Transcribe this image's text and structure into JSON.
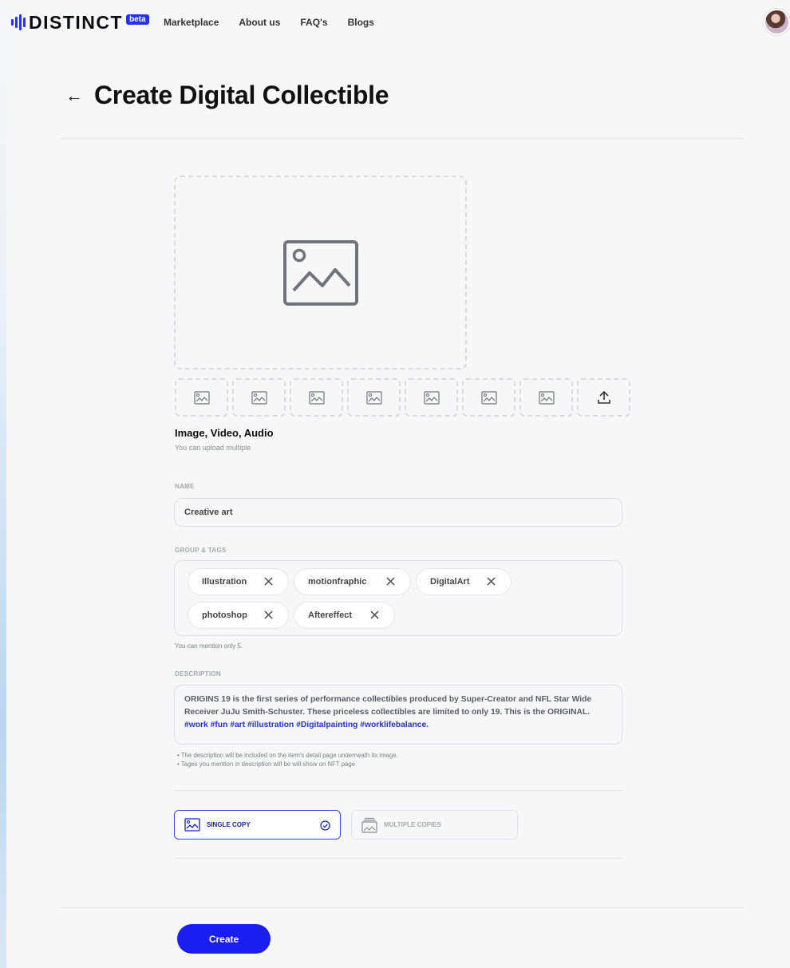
{
  "header": {
    "logo_text": "DISTINCT",
    "logo_badge": "beta",
    "nav": [
      "Marketplace",
      "About us",
      "FAQ's",
      "Blogs"
    ]
  },
  "page": {
    "back_symbol": "←",
    "title": "Create Digital Collectible"
  },
  "media": {
    "title": "Image, Video,  Audio",
    "subtitle": "You can upload multiple",
    "thumb_icons": [
      "image-icon",
      "image-icon",
      "image-icon",
      "image-icon",
      "image-icon",
      "image-icon",
      "image-icon",
      "upload-icon"
    ]
  },
  "name": {
    "label": "NAME",
    "value": "Creative art"
  },
  "tags": {
    "label": "GROUP & TAGS",
    "items": [
      "Illustration",
      "motionfraphic",
      "DigitalArt",
      "photoshop",
      "Aftereffect"
    ],
    "hint": "You can mention only 5."
  },
  "description": {
    "label": "DESCRIPTION",
    "text": "ORIGINS 19 is the first series of performance collectibles produced by Super-Creator and NFL Star Wide Receiver JuJu Smith-Schuster. These priceless collectibles are limited to only 19. This is the ORIGINAL.",
    "hashtags": "#work #fun #art #illustration #Digitalpainting #worklifebalance.",
    "notes": [
      "The description will be included on the item's detail page underneath its image.",
      "Tages you mention in description will be will show on NFT page"
    ]
  },
  "copies": {
    "single": "SINGLE COPY",
    "multiple": "MULTIPLE COPIES",
    "selected": "single"
  },
  "actions": {
    "create": "Create"
  },
  "colors": {
    "accent": "#1a1ff0",
    "text": "#111111",
    "muted": "#a4a7b0"
  }
}
